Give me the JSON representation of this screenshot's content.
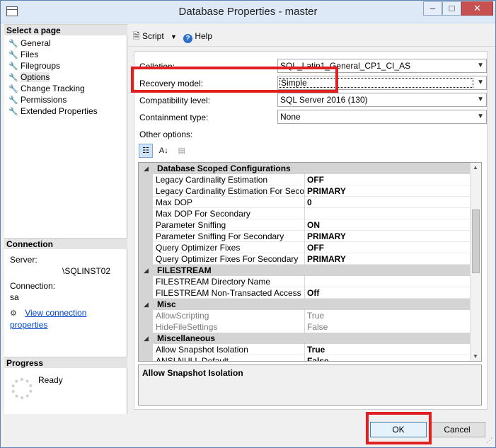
{
  "window": {
    "title": "Database Properties - master",
    "minimize_label": "–",
    "maximize_label": "□",
    "close_label": "✕"
  },
  "left_pane": {
    "select_page_header": "Select a page",
    "pages": [
      "General",
      "Files",
      "Filegroups",
      "Options",
      "Change Tracking",
      "Permissions",
      "Extended Properties"
    ],
    "selected_page": "Options",
    "connection_header": "Connection",
    "server_label": "Server:",
    "server_value": "\\SQLINST02",
    "connection_label": "Connection:",
    "connection_value": "sa",
    "view_connection_link": "View connection properties",
    "progress_header": "Progress",
    "progress_status": "Ready"
  },
  "toolbar": {
    "script_label": "Script",
    "help_label": "Help"
  },
  "options": {
    "collation_label": "Collation:",
    "collation_value": "SQL_Latin1_General_CP1_CI_AS",
    "recovery_model_label": "Recovery model:",
    "recovery_model_value": "Simple",
    "compatibility_label": "Compatibility level:",
    "compatibility_value": "SQL Server 2016 (130)",
    "containment_label": "Containment type:",
    "containment_value": "None",
    "other_options_label": "Other options:"
  },
  "property_grid": {
    "rows": [
      {
        "kind": "cat",
        "name": "Database Scoped Configurations"
      },
      {
        "kind": "item",
        "name": "Legacy Cardinality Estimation",
        "value": "OFF"
      },
      {
        "kind": "item",
        "name": "Legacy Cardinality Estimation For Secondary",
        "value": "PRIMARY"
      },
      {
        "kind": "item",
        "name": "Max DOP",
        "value": "0"
      },
      {
        "kind": "item",
        "name": "Max DOP For Secondary",
        "value": ""
      },
      {
        "kind": "item",
        "name": "Parameter Sniffing",
        "value": "ON"
      },
      {
        "kind": "item",
        "name": "Parameter Sniffing For Secondary",
        "value": "PRIMARY"
      },
      {
        "kind": "item",
        "name": "Query Optimizer Fixes",
        "value": "OFF"
      },
      {
        "kind": "item",
        "name": "Query Optimizer Fixes For Secondary",
        "value": "PRIMARY"
      },
      {
        "kind": "cat",
        "name": "FILESTREAM"
      },
      {
        "kind": "item",
        "name": "FILESTREAM Directory Name",
        "value": ""
      },
      {
        "kind": "item",
        "name": "FILESTREAM Non-Transacted Access",
        "value": "Off"
      },
      {
        "kind": "cat",
        "name": "Misc"
      },
      {
        "kind": "disabled",
        "name": "AllowScripting",
        "value": "True"
      },
      {
        "kind": "disabled",
        "name": "HideFileSettings",
        "value": "False"
      },
      {
        "kind": "cat",
        "name": "Miscellaneous"
      },
      {
        "kind": "item",
        "name": "Allow Snapshot Isolation",
        "value": "True"
      },
      {
        "kind": "item",
        "name": "ANSI NULL Default",
        "value": "False"
      }
    ],
    "description_title": "Allow Snapshot Isolation"
  },
  "buttons": {
    "ok_label": "OK",
    "cancel_label": "Cancel"
  },
  "colors": {
    "highlight": "#e02020",
    "link": "#0044cc"
  }
}
